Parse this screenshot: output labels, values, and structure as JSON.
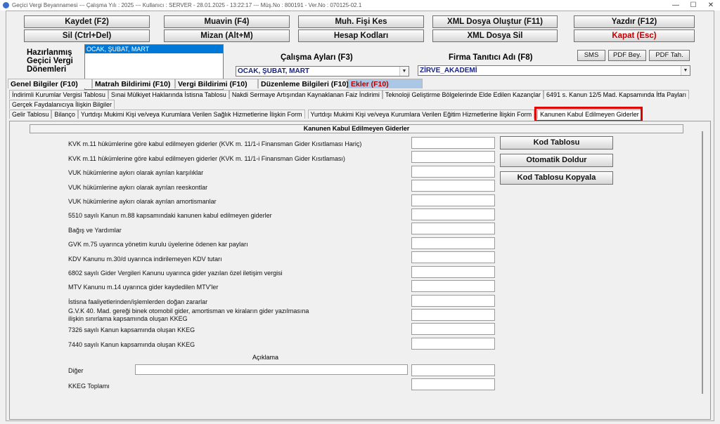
{
  "window": {
    "title": "Geçici Vergi Beyannamesi  ---  Çalışma Yılı : 2025  ---  Kullanıcı : SERVER - 28.01.2025 - 13:22:17  ---  Müş.No : 800191  - Ver.No : 070125-02.1"
  },
  "toolbar": {
    "row1": [
      "Kaydet (F2)",
      "Muavin (F4)",
      "Muh. Fişi Kes",
      "XML Dosya Oluştur (F11)",
      "Yazdır (F12)"
    ],
    "row2": [
      "Sil (Ctrl+Del)",
      "Mizan (Alt+M)",
      "Hesap Kodları",
      "XML Dosya Sil",
      "Kapat (Esc)"
    ]
  },
  "periods": {
    "label_line1": "Hazırlanmış",
    "label_line2": "Geçici Vergi",
    "label_line3": "Dönemleri",
    "selected": "OCAK, ŞUBAT, MART"
  },
  "work_months": {
    "label": "Çalışma Ayları (F3)",
    "value": "OCAK, ŞUBAT, MART"
  },
  "firm": {
    "label": "Firma Tanıtıcı Adı (F8)",
    "value": "ZİRVE_AKADEMİ"
  },
  "small_buttons": [
    "SMS",
    "PDF Bey.",
    "PDF Tah."
  ],
  "main_tabs": [
    "Genel Bilgiler (F10)",
    "Matrah Bildirimi (F10)",
    "Vergi Bildirimi (F10)",
    "Düzenleme Bilgileri (F10)",
    "Ekler (F10)"
  ],
  "sub_tabs_row1": [
    "İndirimli Kurumlar Vergisi Tablosu",
    "Sınai Mülkiyet Haklarında İstisna Tablosu",
    "Nakdi Sermaye Artışından Kaynaklanan Faiz İndirimi",
    "Teknoloji Geliştirme Bölgelerinde Elde Edilen Kazançlar",
    "6491 s. Kanun 12/5 Mad. Kapsamında İtfa Payları"
  ],
  "sub_tabs_row2": [
    "Gerçek Faydalanıcıya İlişkin Bilgiler"
  ],
  "sub_tabs_row3": [
    "Gelir Tablosu",
    "Bilanço",
    "Yurtdışı Mukimi Kişi ve/veya Kurumlara Verilen Sağlık Hizmetlerine İlişkin Form",
    "Yurtdışı Mukimi Kişi ve/veya Kurumlara Verilen Eğitim Hizmetlerine İlişkin Form",
    "Kanunen Kabul Edilmeyen Giderler"
  ],
  "panel": {
    "title": "Kanunen Kabul Edilmeyen Giderler",
    "rows": [
      "KVK m.11 hükümlerine göre kabul edilmeyen giderler (KVK m. 11/1-i Finansman Gider Kısıtlaması Hariç)",
      "KVK m.11 hükümlerine göre kabul edilmeyen giderler (KVK m. 11/1-i Finansman Gider Kısıtlaması)",
      "VUK hükümlerine aykırı olarak ayrılan karşılıklar",
      "VUK hükümlerine aykırı olarak ayrılan reeskontlar",
      "VUK hükümlerine aykırı olarak ayrılan amortismanlar",
      "5510 sayılı Kanun m.88 kapsamındaki kanunen kabul edilmeyen giderler",
      "Bağış ve Yardımlar",
      "GVK m.75 uyarınca yönetim kurulu üyelerine ödenen kar payları",
      "KDV Kanunu m.30/d uyarınca indirilemeyen KDV tutarı",
      "6802 sayılı Gider Vergileri Kanunu uyarınca gider yazılan özel iletişim vergisi",
      "MTV Kanunu m.14 uyarınca gider kaydedilen MTV'ler",
      "İstisna faaliyetlerinden/işlemlerden doğan zararlar",
      "G.V.K 40. Mad. gereği binek otomobil gider, amortisman ve kiraların gider yazılmasına ilişkin sınırlama kapsamında oluşan KKEG",
      "7326 sayılı Kanun kapsamında oluşan KKEG",
      "7440 sayılı Kanun kapsamında oluşan KKEG"
    ],
    "aciklama_label": "Açıklama",
    "diger_label": "Diğer",
    "total_label": "KKEG Toplamı",
    "side_buttons": [
      "Kod Tablosu",
      "Otomatik Doldur",
      "Kod Tablosu Kopyala"
    ]
  }
}
